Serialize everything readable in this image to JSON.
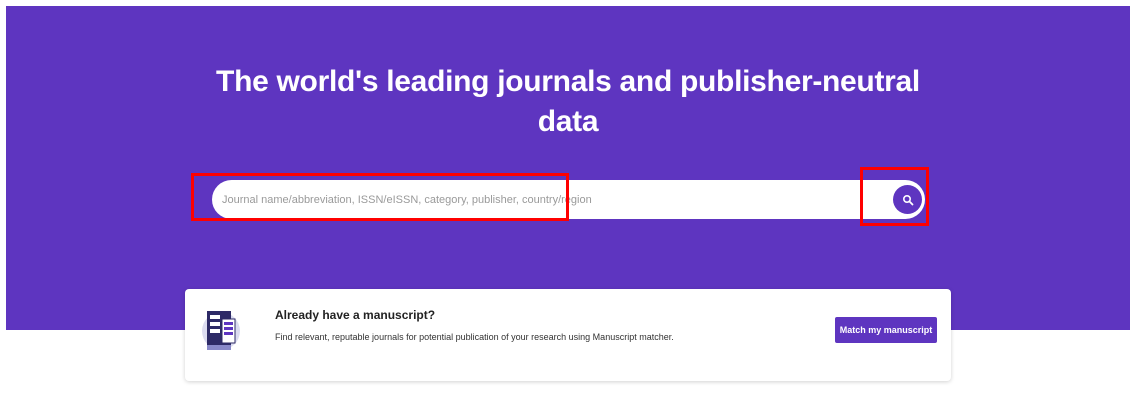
{
  "hero": {
    "title_line1": "The world's leading journals and publisher-neutral",
    "title_line2": "data",
    "background": "#5e35c0"
  },
  "search": {
    "placeholder": "Journal name/abbreviation, ISSN/eISSN, category, publisher, country/region",
    "button_icon": "search-icon"
  },
  "manuscript_card": {
    "icon": "manuscript-document-icon",
    "title": "Already have a manuscript?",
    "description": "Find relevant, reputable journals for potential publication of your research using Manuscript matcher.",
    "button_label": "Match my manuscript"
  },
  "colors": {
    "accent": "#5e35c0",
    "highlight": "#ff0000"
  }
}
